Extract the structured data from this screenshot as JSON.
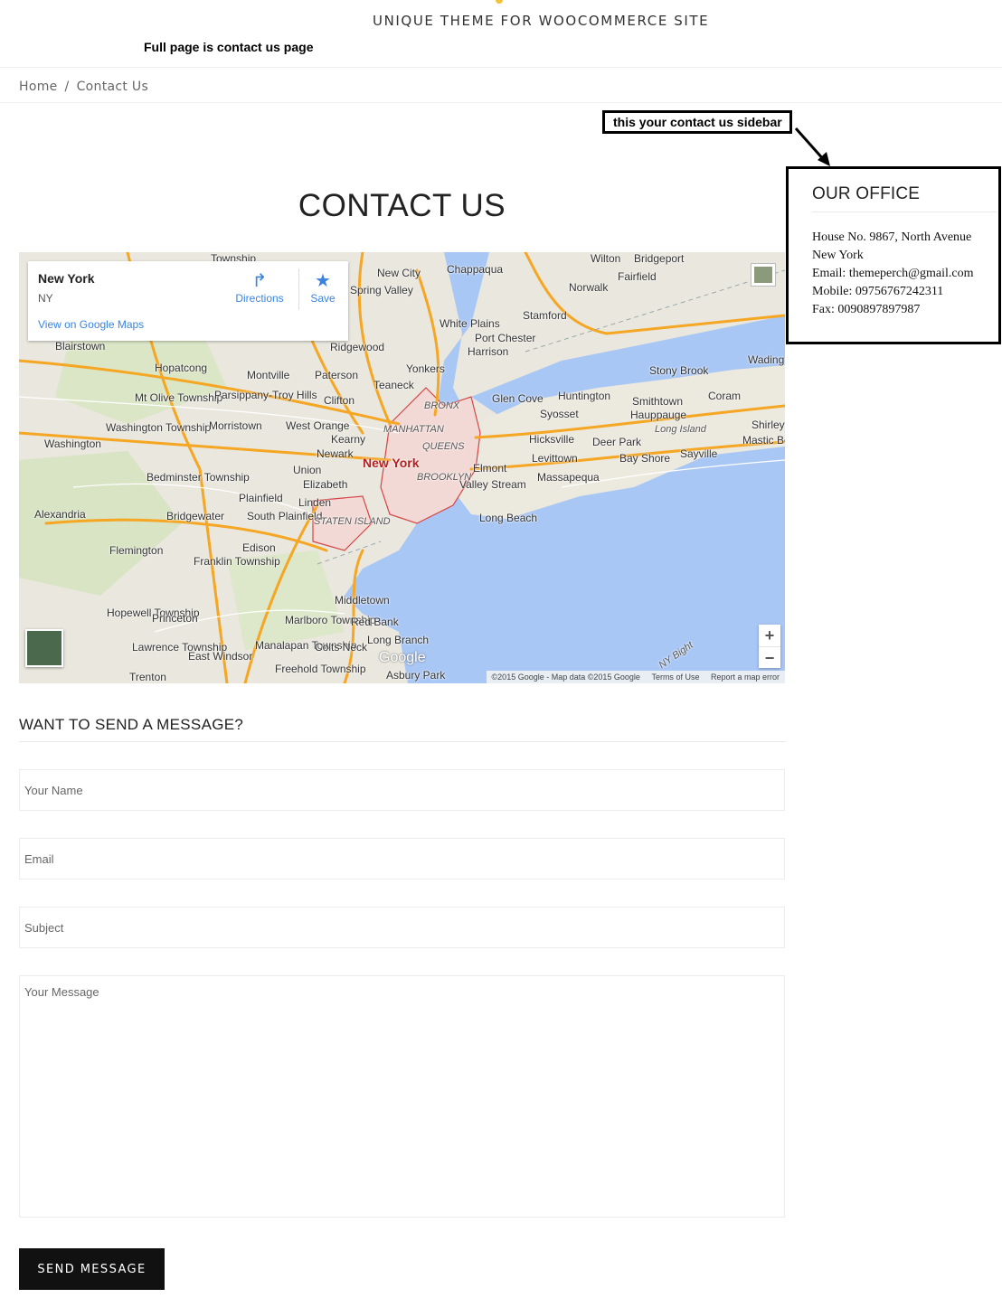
{
  "header": {
    "tagline": "UNIQUE THEME FOR WOOCOMMERCE SITE",
    "note": "Full page is contact us page"
  },
  "breadcrumb": {
    "home": "Home",
    "separator": "/",
    "current": "Contact Us"
  },
  "page_title": "CONTACT US",
  "map": {
    "card": {
      "place": "New York",
      "region": "NY",
      "directions_label": "Directions",
      "save_label": "Save",
      "view_link": "View on Google Maps"
    },
    "footer": {
      "copyright": "©2015 Google - Map data ©2015 Google",
      "terms": "Terms of Use",
      "report": "Report a map error"
    },
    "logo": "Google",
    "zoom_in": "+",
    "zoom_out": "−",
    "labels": [
      "Township",
      "Wilton",
      "Bridgeport",
      "New City",
      "Chappaqua",
      "Fairfield",
      "Spring Valley",
      "Norwalk",
      "Stamford",
      "White Plains",
      "Port Chester",
      "Harrison",
      "Ridgewood",
      "Yonkers",
      "Blairstown",
      "Hopatcong",
      "Montville",
      "Paterson",
      "Teaneck",
      "Stony Brook",
      "Wading",
      "Mt Olive Township",
      "Parsippany-Troy Hills",
      "Clifton",
      "Glen Cove",
      "Huntington",
      "Smithtown",
      "Coram",
      "Hauppauge",
      "Syosset",
      "Washington Township",
      "Washington",
      "Morristown",
      "West Orange",
      "BRONX",
      "MANHATTAN",
      "QUEENS",
      "Hicksville",
      "Long Island",
      "Shirley",
      "Mastic Beach",
      "Newark",
      "Kearny",
      "Deer Park",
      "Sayville",
      "New York",
      "Bedminster Township",
      "Union",
      "BROOKLYN",
      "Elmont",
      "Levittown",
      "Bay Shore",
      "Elizabeth",
      "Valley Stream",
      "Massapequa",
      "Plainfield",
      "Linden",
      "Alexandria",
      "Bridgewater",
      "South Plainfield",
      "STATEN ISLAND",
      "Long Beach",
      "Flemington",
      "Edison",
      "Franklin Township",
      "Middletown",
      "Hopewell Township",
      "Princeton",
      "Marlboro Township",
      "Red Bank",
      "Lawrence Township",
      "East Windsor",
      "Manalapan Township",
      "Colts Neck",
      "Long Branch",
      "Trenton",
      "Freehold Township",
      "Asbury Park",
      "NY Bight"
    ]
  },
  "form": {
    "heading": "WANT TO SEND A MESSAGE?",
    "name_placeholder": "Your Name",
    "email_placeholder": "Email",
    "subject_placeholder": "Subject",
    "message_placeholder": "Your Message",
    "submit_label": "SEND MESSAGE"
  },
  "sidebar": {
    "note": "this your contact us sidebar",
    "title": "OUR OFFICE",
    "address_line1": "House No. 9867, North Avenue",
    "address_line2": "New York",
    "email": "Email: themeperch@gmail.com",
    "mobile": "Mobile: 09756767242311",
    "fax": "Fax: 0090897897987"
  },
  "colors": {
    "accent": "#f2c230",
    "button_bg": "#111111",
    "link_blue": "#3a84df",
    "water": "#a9c7f5",
    "land": "#e8e6dd",
    "highway": "#f5a623",
    "city_boundary": "#d64545"
  }
}
